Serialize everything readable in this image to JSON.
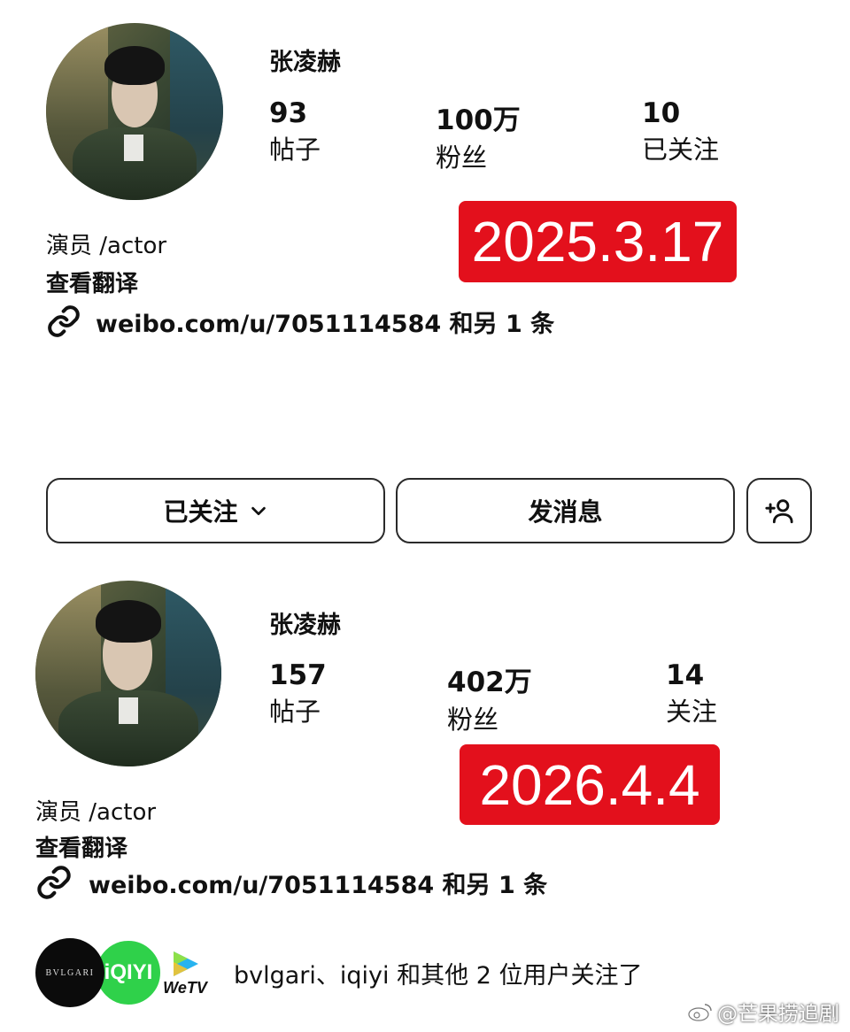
{
  "profile_2025": {
    "name": "张凌赫",
    "stats": [
      {
        "value": "93",
        "label": "帖子"
      },
      {
        "value": "100万",
        "label": "粉丝"
      },
      {
        "value": "10",
        "label": "已关注"
      }
    ],
    "date_badge": "2025.3.17",
    "bio": "演员 /actor",
    "translate": "查看翻译",
    "link": "weibo.com/u/7051114584 和另 1 条"
  },
  "buttons": {
    "following": "已关注",
    "message": "发消息"
  },
  "profile_2026": {
    "name": "张凌赫",
    "stats": [
      {
        "value": "157",
        "label": "帖子"
      },
      {
        "value": "402万",
        "label": "粉丝"
      },
      {
        "value": "14",
        "label": "关注"
      }
    ],
    "date_badge": "2026.4.4",
    "bio": "演员 /actor",
    "translate": "查看翻译",
    "link": "weibo.com/u/7051114584 和另 1 条"
  },
  "followed_by": {
    "logos": {
      "bvlgari": "BVLGARI",
      "iqiyi": "iQIYI",
      "wetv": "WeTV"
    },
    "text": "bvlgari、iqiyi 和其他 2 位用户关注了"
  },
  "watermark": "@芒果捞追剧",
  "colors": {
    "badge_red": "#e3101c",
    "iqiyi_green": "#2fd14a"
  }
}
